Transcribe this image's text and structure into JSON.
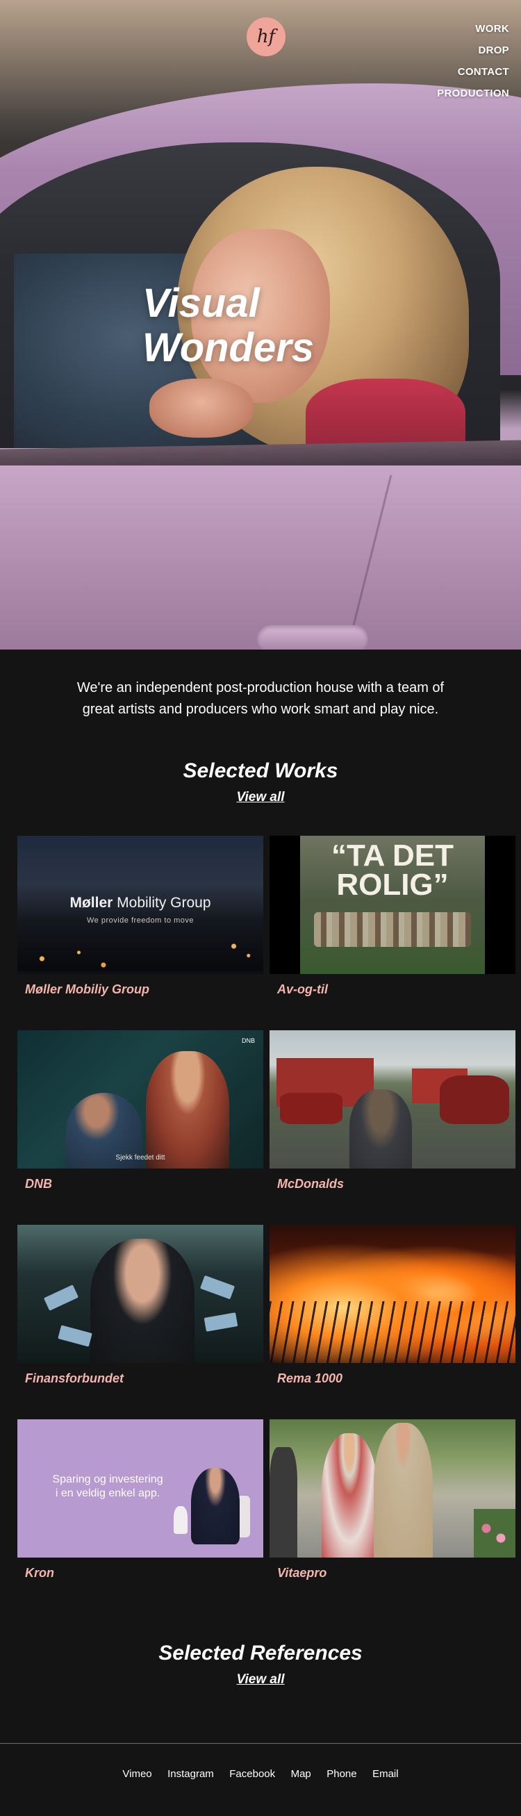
{
  "header": {
    "logo_text": "hf",
    "nav": [
      "WORK",
      "DROP",
      "CONTACT",
      "PRODUCTION"
    ]
  },
  "hero": {
    "title_line1": "Visual",
    "title_line2": "Wonders"
  },
  "intro": {
    "text": "We're an independent post-production house with a team of great artists and producers who work smart and play nice."
  },
  "works": {
    "heading": "Selected Works",
    "view_all": "View all",
    "items": [
      {
        "title": "Møller Mobiliy Group",
        "overlay_brand_bold": "Møller",
        "overlay_brand_light": "Mobility Group",
        "overlay_tagline": "We provide freedom to move"
      },
      {
        "title": "Av-og-til",
        "overlay_big_line1": "“TA DET",
        "overlay_big_line2": "ROLIG”"
      },
      {
        "title": "DNB",
        "overlay_caption": "Sjekk feedet ditt",
        "overlay_corner": "DNB"
      },
      {
        "title": "McDonalds"
      },
      {
        "title": "Finansforbundet"
      },
      {
        "title": "Rema 1000"
      },
      {
        "title": "Kron",
        "overlay_line1": "Sparing og investering",
        "overlay_line2": "i en veldig enkel app."
      },
      {
        "title": "Vitaepro"
      }
    ]
  },
  "references": {
    "heading": "Selected References",
    "view_all": "View all"
  },
  "footer": {
    "links": [
      "Vimeo",
      "Instagram",
      "Facebook",
      "Map",
      "Phone",
      "Email"
    ]
  },
  "colors": {
    "background": "#141414",
    "accent_title": "#f4b6ac",
    "logo_bg": "#f0a59a"
  }
}
